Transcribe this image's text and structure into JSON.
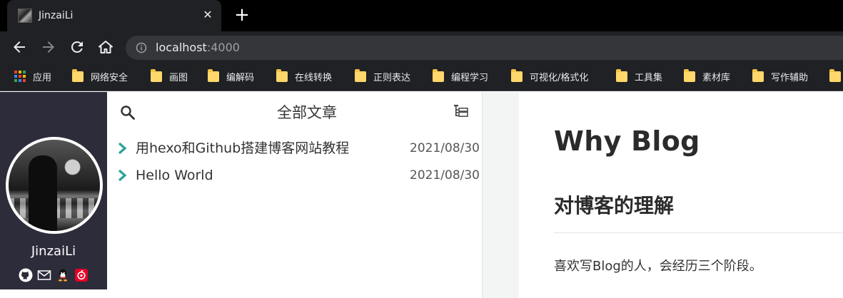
{
  "browser": {
    "tab": {
      "title": "JinzaiLi"
    },
    "address": {
      "host": "localhost",
      "port": ":4000"
    },
    "bookmarks": [
      {
        "label": "应用",
        "icon": "apps-grid-icon"
      },
      {
        "label": "网络安全",
        "icon": "folder-icon"
      },
      {
        "label": "画图",
        "icon": "folder-icon"
      },
      {
        "label": "编解码",
        "icon": "folder-icon"
      },
      {
        "label": "在线转换",
        "icon": "folder-icon"
      },
      {
        "label": "正则表达",
        "icon": "folder-icon"
      },
      {
        "label": "编程学习",
        "icon": "folder-icon"
      },
      {
        "label": "可视化/格式化",
        "icon": "folder-icon"
      },
      {
        "label": "工具集",
        "icon": "folder-icon"
      },
      {
        "label": "素材库",
        "icon": "folder-icon"
      },
      {
        "label": "写作辅助",
        "icon": "folder-icon"
      }
    ]
  },
  "sidebar": {
    "author": "JinzaiLi",
    "social": [
      {
        "icon": "github-icon"
      },
      {
        "icon": "mail-icon"
      },
      {
        "icon": "qq-icon"
      },
      {
        "icon": "netease-music-icon"
      }
    ]
  },
  "post_list": {
    "title": "全部文章",
    "posts": [
      {
        "title": "用hexo和Github搭建博客网站教程",
        "date": "2021/08/30"
      },
      {
        "title": "Hello World",
        "date": "2021/08/30"
      }
    ]
  },
  "article": {
    "title": "Why Blog",
    "heading": "对博客的理解",
    "paragraph": "喜欢写Blog的人，会经历三个阶段。"
  },
  "colors": {
    "accent": "#2ba19a",
    "sidebar_bg": "#2d2c3a",
    "chrome_bg": "#202124",
    "folder": "#ffd76a"
  }
}
